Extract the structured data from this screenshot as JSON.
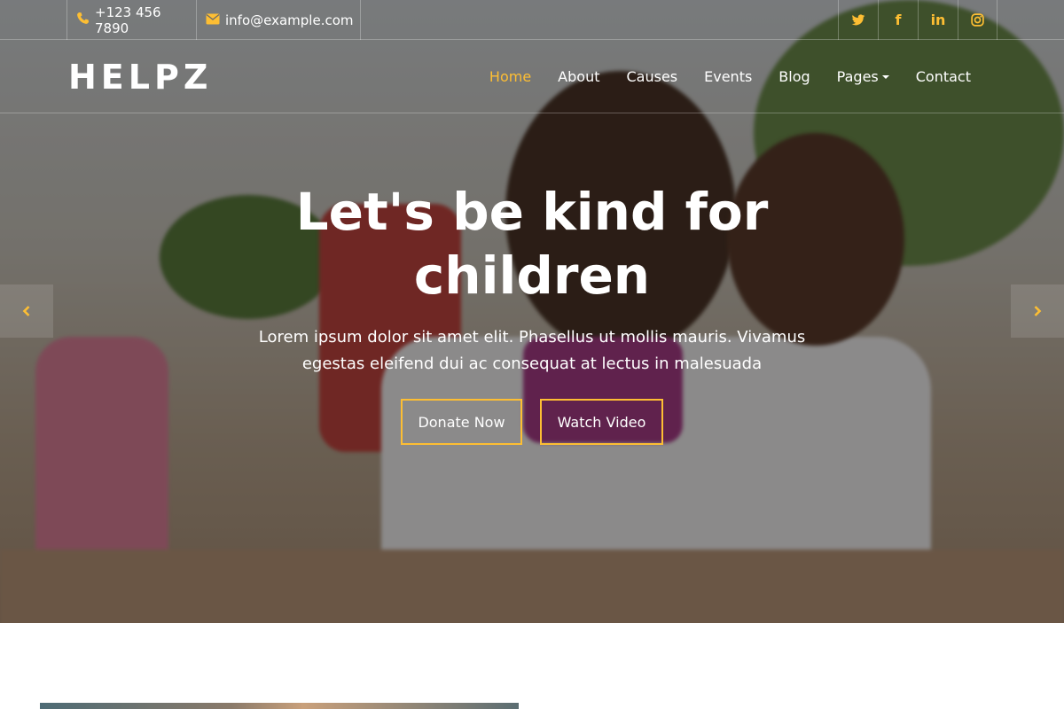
{
  "colors": {
    "accent": "#FDBE33",
    "text": "#ffffff"
  },
  "topbar": {
    "phone": {
      "icon": "phone-icon",
      "text": "+123 456 7890"
    },
    "email": {
      "icon": "envelope-icon",
      "text": "info@example.com"
    },
    "socials": [
      {
        "icon": "twitter-icon",
        "glyph": "🐦"
      },
      {
        "icon": "facebook-icon",
        "glyph": "f"
      },
      {
        "icon": "linkedin-icon",
        "glyph": "in"
      },
      {
        "icon": "instagram-icon",
        "glyph": "◎"
      }
    ]
  },
  "navbar": {
    "brand": "HELPZ",
    "items": [
      {
        "label": "Home",
        "active": true
      },
      {
        "label": "About"
      },
      {
        "label": "Causes"
      },
      {
        "label": "Events"
      },
      {
        "label": "Blog"
      },
      {
        "label": "Pages",
        "dropdown": true
      },
      {
        "label": "Contact"
      }
    ]
  },
  "hero": {
    "title": "Let's be kind for children",
    "text": "Lorem ipsum dolor sit amet elit. Phasellus ut mollis mauris. Vivamus egestas eleifend dui ac consequat at lectus in malesuada",
    "buttons": {
      "donate": "Donate Now",
      "watch": "Watch Video"
    }
  }
}
